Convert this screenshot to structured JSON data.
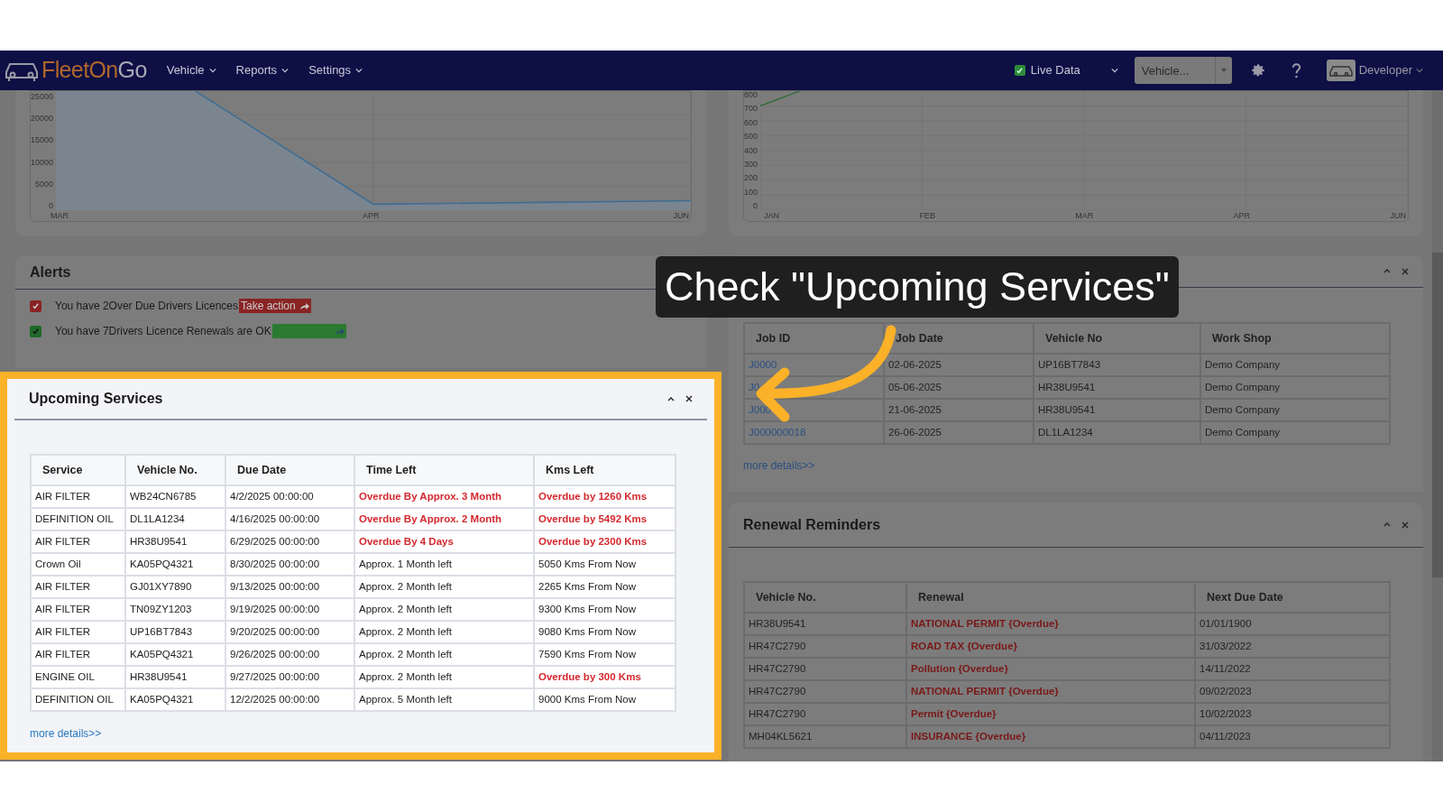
{
  "header": {
    "logo": {
      "text_1": "FleetOn",
      "text_2": "Go"
    },
    "menu": [
      {
        "label": "Vehicle"
      },
      {
        "label": "Reports"
      },
      {
        "label": "Settings"
      }
    ],
    "live_data": {
      "label": "Live Data",
      "checked": true
    },
    "vehicle_select": {
      "placeholder": "Vehicle..."
    },
    "user": {
      "name": "Developer"
    }
  },
  "left_chart": {
    "y_labels": [
      "25000",
      "20000",
      "15000",
      "10000",
      "5000",
      "0"
    ],
    "x_labels": [
      "MAR",
      "APR",
      "JUN"
    ]
  },
  "right_chart": {
    "y_labels": [
      "800",
      "700",
      "600",
      "500",
      "400",
      "300",
      "200",
      "100",
      "0"
    ],
    "x_labels": [
      "JAN",
      "FEB",
      "MAR",
      "APR",
      "JUN"
    ]
  },
  "alerts": {
    "title": "Alerts",
    "items": [
      {
        "kind": "danger",
        "checked": true,
        "text": "You have 2Over Due Drivers Licences",
        "action": "Take action"
      },
      {
        "kind": "ok",
        "checked": true,
        "text": "You have 7Drivers Licence Renewals are OK"
      }
    ]
  },
  "upcoming_services": {
    "title": "Upcoming Services",
    "highlighted": true,
    "columns": [
      "Service",
      "Vehicle No.",
      "Due Date",
      "Time Left",
      "Kms Left"
    ],
    "rows": [
      {
        "service": "AIR FILTER",
        "vehicle_no": "WB24CN6785",
        "due_date": "4/2/2025 00:00:00",
        "time_left": "Overdue By Approx. 3 Month",
        "time_overdue": true,
        "kms_left": "Overdue by 1260 Kms",
        "kms_overdue": true
      },
      {
        "service": "DEFINITION OIL",
        "vehicle_no": "DL1LA1234",
        "due_date": "4/16/2025 00:00:00",
        "time_left": "Overdue By Approx. 2 Month",
        "time_overdue": true,
        "kms_left": "Overdue by 5492 Kms",
        "kms_overdue": true
      },
      {
        "service": "AIR FILTER",
        "vehicle_no": "HR38U9541",
        "due_date": "6/29/2025 00:00:00",
        "time_left": "Overdue By 4 Days",
        "time_overdue": true,
        "kms_left": "Overdue by 2300 Kms",
        "kms_overdue": true
      },
      {
        "service": "Crown Oil",
        "vehicle_no": "KA05PQ4321",
        "due_date": "8/30/2025 00:00:00",
        "time_left": "Approx. 1 Month left",
        "time_overdue": false,
        "kms_left": "5050 Kms From Now",
        "kms_overdue": false
      },
      {
        "service": "AIR FILTER",
        "vehicle_no": "GJ01XY7890",
        "due_date": "9/13/2025 00:00:00",
        "time_left": "Approx. 2 Month left",
        "time_overdue": false,
        "kms_left": "2265 Kms From Now",
        "kms_overdue": false
      },
      {
        "service": "AIR FILTER",
        "vehicle_no": "TN09ZY1203",
        "due_date": "9/19/2025 00:00:00",
        "time_left": "Approx. 2 Month left",
        "time_overdue": false,
        "kms_left": "9300 Kms From Now",
        "kms_overdue": false
      },
      {
        "service": "AIR FILTER",
        "vehicle_no": "UP16BT7843",
        "due_date": "9/20/2025 00:00:00",
        "time_left": "Approx. 2 Month left",
        "time_overdue": false,
        "kms_left": "9080 Kms From Now",
        "kms_overdue": false
      },
      {
        "service": "AIR FILTER",
        "vehicle_no": "KA05PQ4321",
        "due_date": "9/26/2025 00:00:00",
        "time_left": "Approx. 2 Month left",
        "time_overdue": false,
        "kms_left": "7590 Kms From Now",
        "kms_overdue": false
      },
      {
        "service": "ENGINE OIL",
        "vehicle_no": "HR38U9541",
        "due_date": "9/27/2025 00:00:00",
        "time_left": "Approx. 2 Month left",
        "time_overdue": false,
        "kms_left": "Overdue by 300 Kms",
        "kms_overdue": true
      },
      {
        "service": "DEFINITION OIL",
        "vehicle_no": "KA05PQ4321",
        "due_date": "12/2/2025 00:00:00",
        "time_left": "Approx. 5 Month left",
        "time_overdue": false,
        "kms_left": "9000 Kms From Now",
        "kms_overdue": false
      }
    ],
    "more_details": "more details>>"
  },
  "open_job_cards": {
    "columns": [
      "Job ID",
      "Job Date",
      "Vehicle No",
      "Work Shop"
    ],
    "rows": [
      {
        "job_id": "J0000",
        "job_date": "02-06-2025",
        "vehicle_no": "UP16BT7843",
        "workshop": "Demo Company"
      },
      {
        "job_id": "J0",
        "job_date": "05-06-2025",
        "vehicle_no": "HR38U9541",
        "workshop": "Demo Company"
      },
      {
        "job_id": "J000",
        "job_date": "21-06-2025",
        "vehicle_no": "HR38U9541",
        "workshop": "Demo Company"
      },
      {
        "job_id": "J000000018",
        "job_date": "26-06-2025",
        "vehicle_no": "DL1LA1234",
        "workshop": "Demo Company"
      }
    ],
    "more_details": "more details>>"
  },
  "renewal_reminders": {
    "title": "Renewal Reminders",
    "columns": [
      "Vehicle No.",
      "Renewal",
      "Next Due Date"
    ],
    "rows": [
      {
        "vehicle_no": "HR38U9541",
        "renewal": "NATIONAL PERMIT {Overdue}",
        "overdue": true,
        "next_due_date": "01/01/1900"
      },
      {
        "vehicle_no": "HR47C2790",
        "renewal": "ROAD TAX {Overdue}",
        "overdue": true,
        "next_due_date": "31/03/2022"
      },
      {
        "vehicle_no": "HR47C2790",
        "renewal": "Pollution {Overdue}",
        "overdue": true,
        "next_due_date": "14/11/2022"
      },
      {
        "vehicle_no": "HR47C2790",
        "renewal": "NATIONAL PERMIT {Overdue}",
        "overdue": true,
        "next_due_date": "09/02/2023"
      },
      {
        "vehicle_no": "HR47C2790",
        "renewal": "Permit {Overdue}",
        "overdue": true,
        "next_due_date": "10/02/2023"
      },
      {
        "vehicle_no": "MH04KL5621",
        "renewal": "INSURANCE {Overdue}",
        "overdue": true,
        "next_due_date": "04/11/2023"
      }
    ]
  },
  "callout": {
    "text": "Check \"Upcoming Services\""
  }
}
